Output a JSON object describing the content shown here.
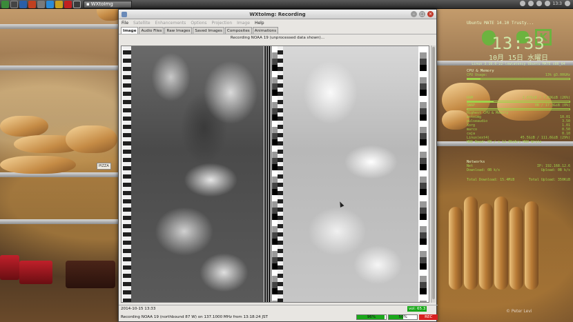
{
  "taskbar": {
    "active_task": "WXtoImg",
    "tray": {
      "time_short": "13:3"
    }
  },
  "window": {
    "title": "WXtoImg: Recording",
    "menus": [
      {
        "label": "File",
        "enabled": true
      },
      {
        "label": "Satellite",
        "enabled": false
      },
      {
        "label": "Enhancements",
        "enabled": false
      },
      {
        "label": "Options",
        "enabled": false
      },
      {
        "label": "Projection",
        "enabled": false
      },
      {
        "label": "Image",
        "enabled": false
      },
      {
        "label": "Help",
        "enabled": true
      }
    ],
    "tabs": [
      {
        "label": "Image",
        "active": true
      },
      {
        "label": "Audio Files",
        "active": false
      },
      {
        "label": "Raw Images",
        "active": false
      },
      {
        "label": "Saved Images",
        "active": false
      },
      {
        "label": "Composites",
        "active": false
      },
      {
        "label": "Animations",
        "active": false
      }
    ],
    "image_caption": "Recording NOAA 19 (unprocessed data shown)...",
    "status_date": "2014-10-15  13:33",
    "vol_label": "vol: 65.3",
    "status_message": "Recording NOAA 19 (northbound 87 W) on 137.1000 MHz from 13:18:24 JST",
    "meters": [
      {
        "label": "96%",
        "level": 0.96
      },
      {
        "label": "50%",
        "level": 0.5
      }
    ],
    "rec_label": "REC"
  },
  "conky": {
    "os": "Ubuntu MATE 14.10 Trusty...",
    "time": "13:33",
    "date": "10月 15日 水曜日",
    "kernel": "Linux 3.16.0-22-lowlatency Ubuntu MATE  x86_64",
    "cpu_title": "CPU & Memory",
    "cpu_usage": "CPU Usage:",
    "cpu_freq": "13% @3.00GHz",
    "ram_label": "RAM",
    "ram_val": "2.07GiB / 7.69GiB (26%)",
    "swap_label": "SWAP",
    "swap_val": "0B / 17.3GiB (0%)",
    "highest_cpu": "Highest CPU & Memory",
    "processes": [
      [
        "wxtoimg",
        "10.01"
      ],
      [
        "pulseaudio",
        "3.50"
      ],
      [
        "Xorg",
        "1.01"
      ],
      [
        "marco",
        "0.50"
      ],
      [
        "caja",
        "0.10"
      ]
    ],
    "disk_label": "Linux(ext4)",
    "disk_val": "45.5GiB / 111.6GiB (29%)",
    "hdd": "HDD Read: 0B / s   12.0KiB/s HDD Write",
    "net_title": "Networks",
    "net_label": "Net",
    "ip": "IP: 192.168.12.6",
    "download": "Download: 0B  k/s",
    "upload": "Upload: 0B  k/s",
    "total_down": "Total Download: 15.4MiB",
    "total_up": "Total Upload: 350KiB"
  },
  "watermark": "© Peter Levi"
}
